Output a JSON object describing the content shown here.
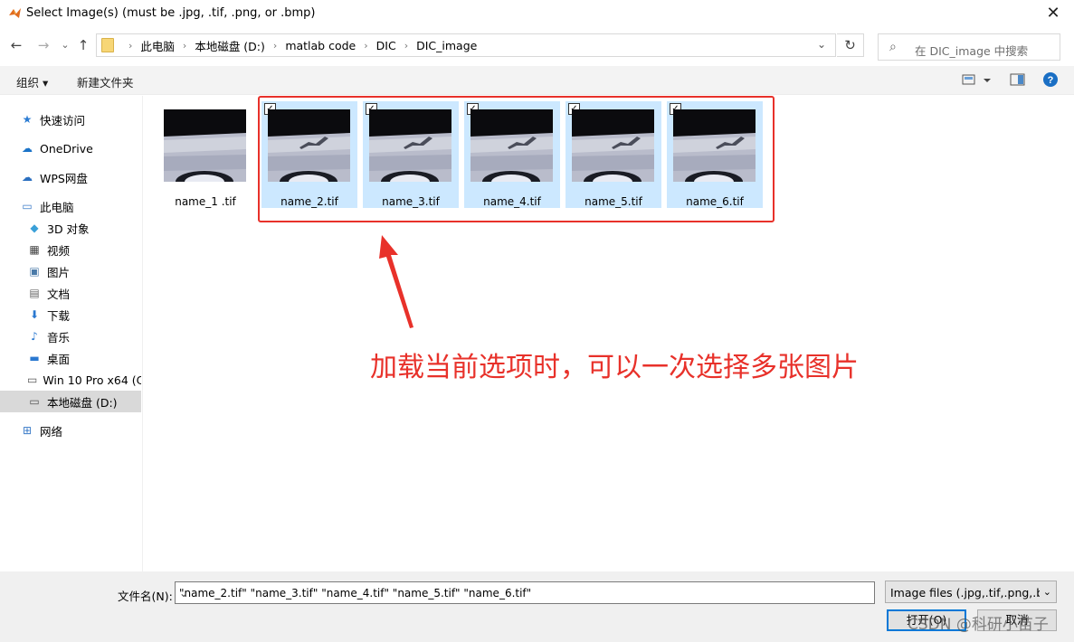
{
  "window": {
    "title": "Select Image(s) (must be .jpg, .tif, .png, or .bmp)",
    "close": "✕"
  },
  "nav": {
    "back": "←",
    "forward": "→",
    "recent": "⌄",
    "up": "↑",
    "breadcrumbs": [
      "此电脑",
      "本地磁盘 (D:)",
      "matlab code",
      "DIC",
      "DIC_image"
    ],
    "search_placeholder": "在 DIC_image 中搜索"
  },
  "toolbar": {
    "organize": "组织 ▾",
    "new_folder": "新建文件夹"
  },
  "sidebar": {
    "items": [
      {
        "label": "快速访问",
        "icon": "star-icon"
      },
      {
        "label": "OneDrive",
        "icon": "cloud-icon"
      },
      {
        "label": "WPS网盘",
        "icon": "cloud-icon"
      },
      {
        "label": "此电脑",
        "icon": "computer-icon"
      },
      {
        "label": "3D 对象",
        "icon": "cube-icon"
      },
      {
        "label": "视频",
        "icon": "film-icon"
      },
      {
        "label": "图片",
        "icon": "picture-icon"
      },
      {
        "label": "文档",
        "icon": "document-icon"
      },
      {
        "label": "下载",
        "icon": "download-icon"
      },
      {
        "label": "音乐",
        "icon": "music-icon"
      },
      {
        "label": "桌面",
        "icon": "desktop-icon"
      },
      {
        "label": "Win 10 Pro x64 (C",
        "icon": "drive-icon"
      },
      {
        "label": "本地磁盘 (D:)",
        "icon": "drive-icon"
      },
      {
        "label": "网络",
        "icon": "network-icon"
      }
    ]
  },
  "files": [
    {
      "name": "name_1 .tif",
      "selected": false
    },
    {
      "name": "name_2.tif",
      "selected": true
    },
    {
      "name": "name_3.tif",
      "selected": true
    },
    {
      "name": "name_4.tif",
      "selected": true
    },
    {
      "name": "name_5.tif",
      "selected": true
    },
    {
      "name": "name_6.tif",
      "selected": true
    }
  ],
  "annotation": "加载当前选项时，可以一次选择多张图片",
  "bottom": {
    "filename_label": "文件名(N):",
    "filename_value": "\"name_2.tif\" \"name_3.tif\" \"name_4.tif\" \"name_5.tif\" \"name_6.tif\"",
    "filetype": "Image files (.jpg,.tif,.png,.bm",
    "open_button": "打开(O)",
    "cancel_button": "取消"
  },
  "watermark": "CSDN @科研小苗子",
  "colors": {
    "annotation_red": "#e8312a",
    "selection_blue": "#cce8ff",
    "accent": "#0078d7"
  }
}
